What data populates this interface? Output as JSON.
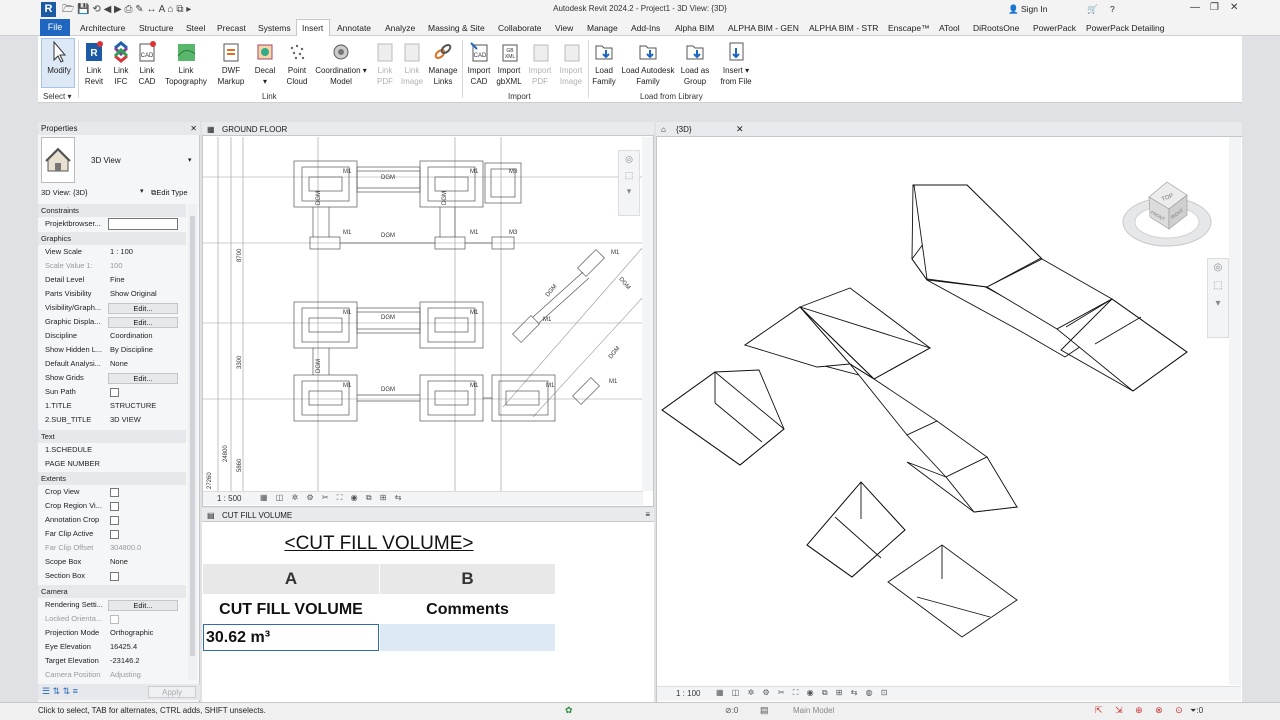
{
  "app": {
    "window_title": "Autodesk Revit 2024.2 - Project1 - 3D View: {3D}",
    "user": "Sign In",
    "logo": "R"
  },
  "menu": {
    "file": "File",
    "tabs": [
      "Architecture",
      "Structure",
      "Steel",
      "Precast",
      "Systems",
      "Insert",
      "Annotate",
      "Analyze",
      "Massing & Site",
      "Collaborate",
      "View",
      "Manage",
      "Add-Ins",
      "Alpha BIM",
      "ALPHA BIM - GEN",
      "ALPHA BIM - STR",
      "Enscape™",
      "ATool",
      "DiRootsOne",
      "PowerPack",
      "PowerPack Detailing"
    ]
  },
  "ribbon": {
    "modify": "Modify",
    "select": "Select",
    "link_revit": [
      "Link",
      "Revit"
    ],
    "link_ifc": [
      "Link",
      "IFC"
    ],
    "link_cad": [
      "Link",
      "CAD"
    ],
    "link_topo": [
      "Link",
      "Topography"
    ],
    "dwf": [
      "DWF",
      "Markup"
    ],
    "decal": "Decal",
    "point_cloud": [
      "Point",
      "Cloud"
    ],
    "coord_model": [
      "Coordination",
      "Model"
    ],
    "link_pdf": [
      "Link",
      "PDF"
    ],
    "link_image": [
      "Link",
      "Image"
    ],
    "manage_links": [
      "Manage",
      "Links"
    ],
    "import_cad": [
      "Import",
      "CAD"
    ],
    "import_gbxml": [
      "Import",
      "gbXML"
    ],
    "import_pdf": [
      "Import",
      "PDF"
    ],
    "import_image": [
      "Import",
      "Image"
    ],
    "load_family": [
      "Load",
      "Family"
    ],
    "load_autodesk": [
      "Load Autodesk",
      "Family"
    ],
    "load_group": [
      "Load as",
      "Group"
    ],
    "insert_file": [
      "Insert",
      "from File"
    ],
    "group_link": "Link",
    "group_import": "Import",
    "group_library": "Load from Library"
  },
  "properties": {
    "title": "Properties",
    "type_name": "3D View",
    "selector": "3D View: {3D}",
    "edit_type": "Edit Type",
    "apply": "Apply",
    "sections": {
      "constraints": "Constraints",
      "graphics": "Graphics",
      "text": "Text",
      "extents": "Extents",
      "camera": "Camera"
    },
    "rows": {
      "projektbrowser": "Projektbrowser...",
      "view_scale": [
        "View Scale",
        "1 : 100"
      ],
      "scale_value": [
        "Scale Value    1:",
        "100"
      ],
      "detail_level": [
        "Detail Level",
        "Fine"
      ],
      "parts_visibility": [
        "Parts Visibility",
        "Show Original"
      ],
      "vis_graph": "Visibility/Graph...",
      "graphic_disp": "Graphic Displa...",
      "discipline": [
        "Discipline",
        "Coordination"
      ],
      "show_hidden": [
        "Show Hidden L...",
        "By Discipline"
      ],
      "default_analysis": [
        "Default Analysi...",
        "None"
      ],
      "show_grids": "Show Grids",
      "sun_path": "Sun Path",
      "title1": [
        "1.TITLE",
        "STRUCTURE"
      ],
      "subtitle2": [
        "2.SUB_TITLE",
        "3D VIEW"
      ],
      "schedule1": "1.SCHEDULE",
      "page_number": "PAGE NUMBER",
      "crop_view": "Crop View",
      "crop_region": "Crop Region Vi...",
      "annotation_crop": "Annotation Crop",
      "far_clip_active": "Far Clip Active",
      "far_clip_offset": [
        "Far Clip Offset",
        "304800.0"
      ],
      "scope_box": [
        "Scope Box",
        "None"
      ],
      "section_box": "Section Box",
      "rendering": "Rendering Setti...",
      "locked_orient": "Locked Orienta...",
      "projection": [
        "Projection Mode",
        "Orthographic"
      ],
      "eye_elev": [
        "Eye Elevation",
        "16425.4"
      ],
      "target_elev": [
        "Target Elevation",
        "-23146.2"
      ],
      "camera_pos": [
        "Camera Position",
        "Adjusting"
      ]
    },
    "edit": "Edit..."
  },
  "plan": {
    "tab": "GROUND FLOOR",
    "scale": "1 : 500",
    "labels": {
      "m1": "M1",
      "m3": "M3",
      "dgm": "DGM"
    },
    "dims": [
      "8700",
      "3300",
      "24800",
      "5860",
      "27260"
    ]
  },
  "schedule": {
    "tab": "CUT FILL VOLUME",
    "title": "<CUT FILL VOLUME>",
    "col_a": "A",
    "col_b": "B",
    "header_a": "CUT FILL VOLUME",
    "header_b": "Comments",
    "value_a": "30.62 m³",
    "value_b": ""
  },
  "view3d": {
    "tab": "{3D}",
    "scale": "1 : 100",
    "cube_top": "TOP",
    "cube_front": "FRONT",
    "cube_right": "RIGHT"
  },
  "status": {
    "hint": "Click to select, TAB for alternates, CTRL adds, SHIFT unselects.",
    "zero": ":0",
    "model": "Main Model",
    "filter": ":0"
  }
}
